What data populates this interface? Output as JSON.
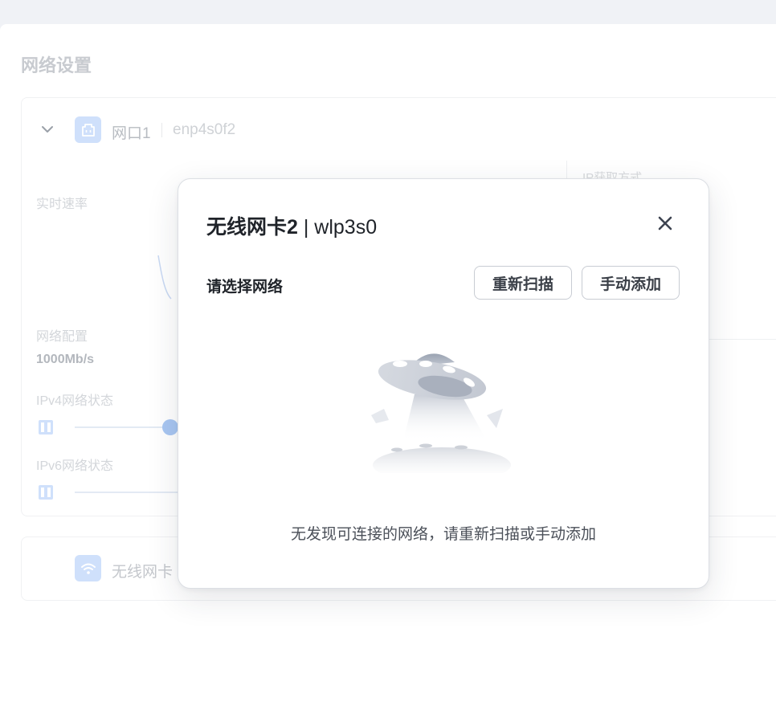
{
  "page": {
    "title": "网络设置"
  },
  "interfaces": [
    {
      "name": "网口1",
      "device": "enp4s0f2",
      "realtime_rate_label": "实时速率",
      "config_label": "网络配置",
      "speed": "1000Mb/s",
      "ipv4_label": "IPv4网络状态",
      "ipv6_label": "IPv6网络状态",
      "ip_hint": "IP获取方式"
    },
    {
      "name": "无线网卡"
    }
  ],
  "modal": {
    "title_main": "无线网卡2",
    "title_sep": " | ",
    "title_device": "wlp3s0",
    "section_label": "请选择网络",
    "rescan_label": "重新扫描",
    "manual_add_label": "手动添加",
    "empty_message": "无发现可连接的网络，请重新扫描或手动添加",
    "icons": {
      "close": "close-icon",
      "empty": "ufo-empty-illustration"
    }
  },
  "colors": {
    "accent_light": "#cfe0fb",
    "text_primary": "#1f2329",
    "overlay_bg": "#f0f2f6"
  }
}
